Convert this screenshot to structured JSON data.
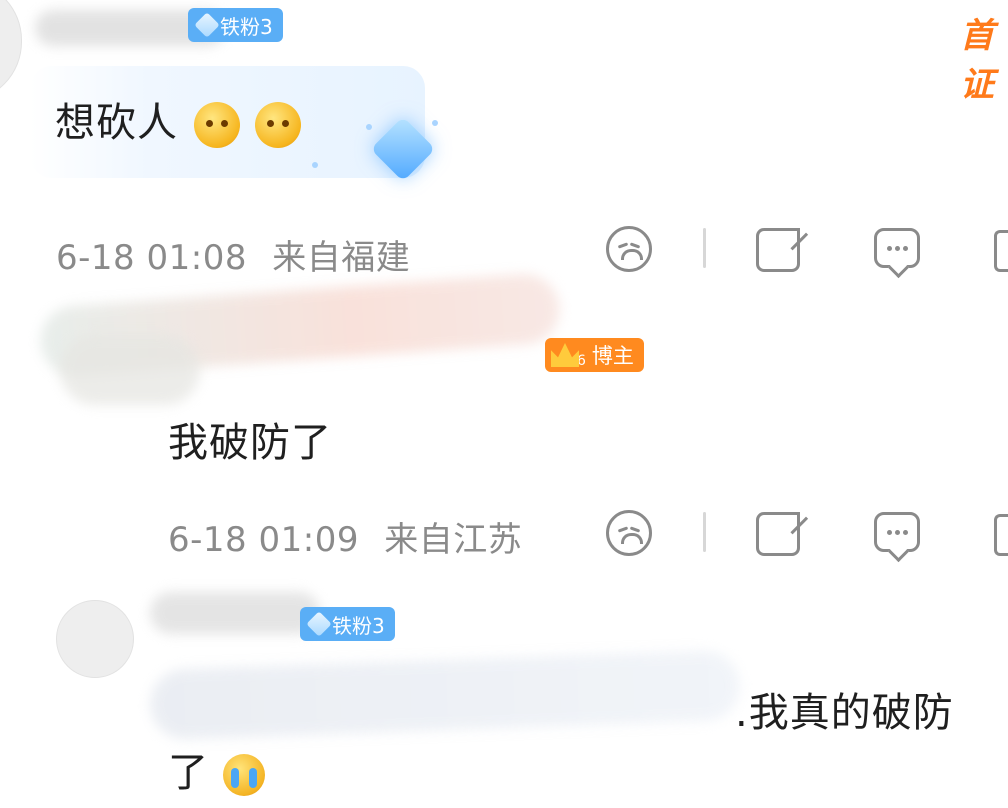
{
  "top_right": {
    "brand": "首证"
  },
  "comments": [
    {
      "badge": "铁粉3",
      "content": "想砍人",
      "emojis": [
        "drool-emoji",
        "drool-emoji"
      ],
      "time": "6-18 01:08",
      "location": "来自福建"
    },
    {
      "host_level": "6",
      "badge": "博主",
      "content": "我破防了",
      "time": "6-18 01:09",
      "location": "来自江苏"
    },
    {
      "badge": "铁粉3",
      "content_visible": ".我真的破防",
      "content_line2": "了",
      "emoji": "crying-emoji"
    }
  ],
  "icons": [
    "sad-face-icon",
    "share-icon",
    "comment-icon",
    "like-icon"
  ],
  "colors": {
    "badge_blue": "#5aaef6",
    "host_orange": "#ff8a1f",
    "meta_gray": "#8a8a8a"
  }
}
